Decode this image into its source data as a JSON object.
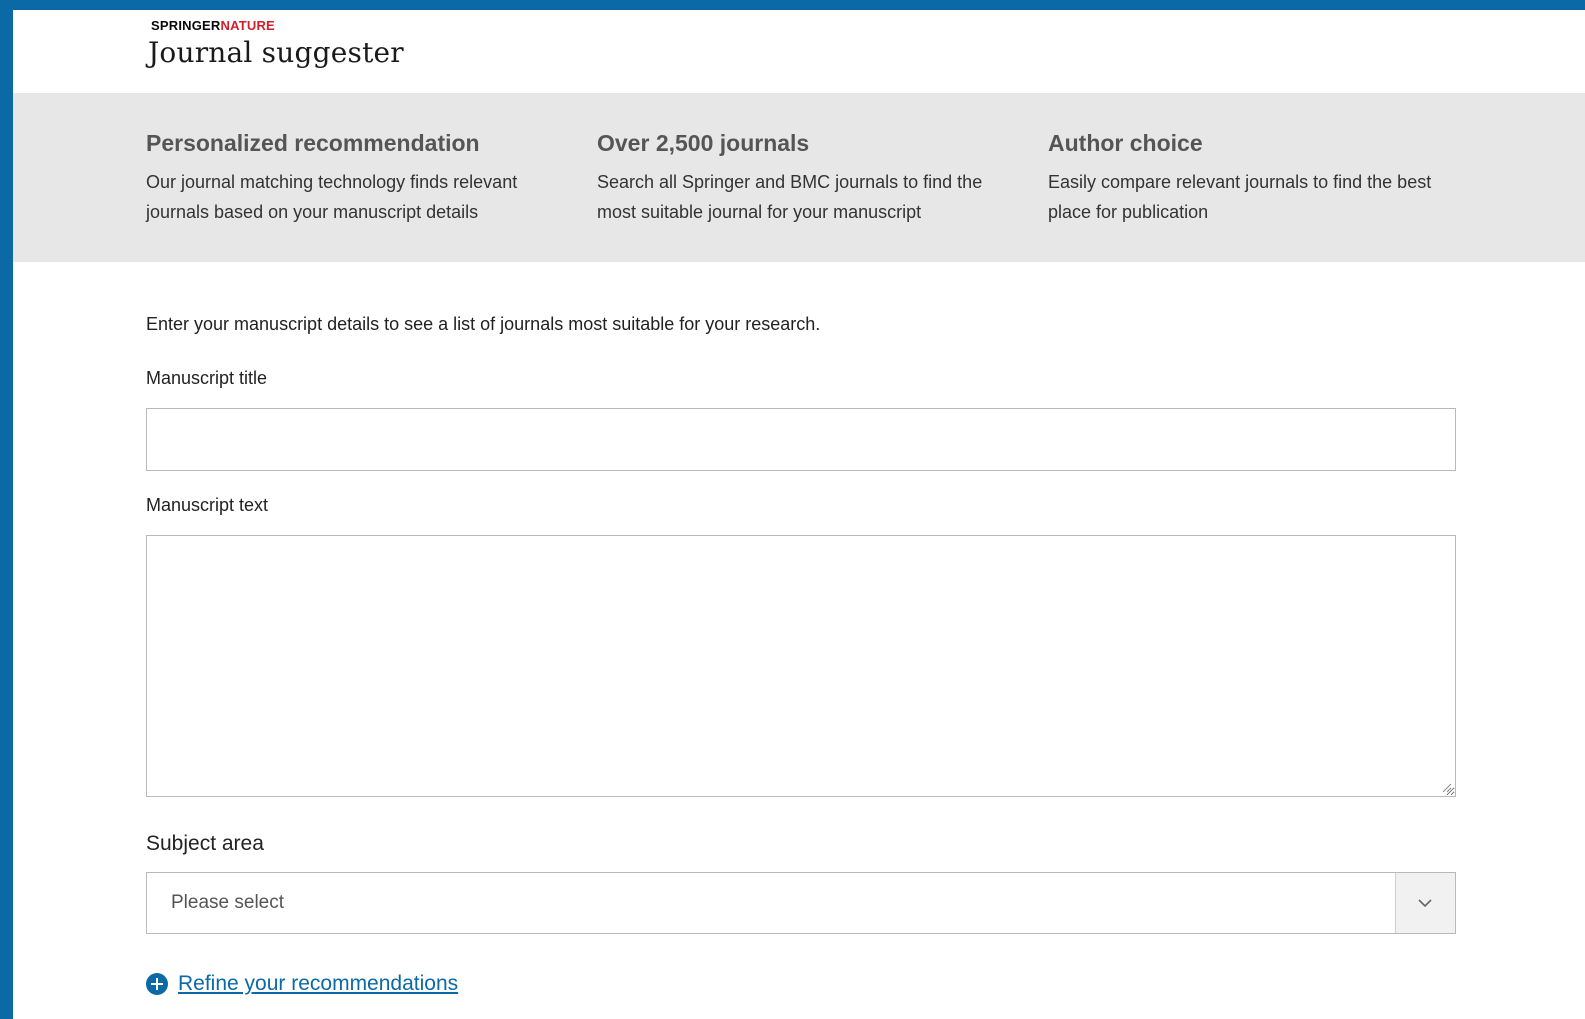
{
  "brand": {
    "part1": "SPRINGER",
    "part2": "NATURE"
  },
  "app_title": "Journal suggester",
  "features": [
    {
      "title": "Personalized recommendation",
      "description": "Our journal matching technology finds relevant journals based on your manuscript details"
    },
    {
      "title": "Over 2,500 journals",
      "description": "Search all Springer and BMC journals to find the most suitable journal for your manuscript"
    },
    {
      "title": "Author choice",
      "description": "Easily compare relevant journals to find the best place for publication"
    }
  ],
  "form": {
    "intro": "Enter your manuscript details to see a list of journals most suitable for your research.",
    "title_label": "Manuscript title",
    "title_value": "",
    "text_label": "Manuscript text",
    "text_value": "",
    "subject_label": "Subject area",
    "subject_value": "Please select",
    "refine_link": "Refine your recommendations"
  },
  "colors": {
    "accent": "#0b6aa5",
    "brand_red": "#d21f2b",
    "banner_bg": "#e7e7e7"
  }
}
